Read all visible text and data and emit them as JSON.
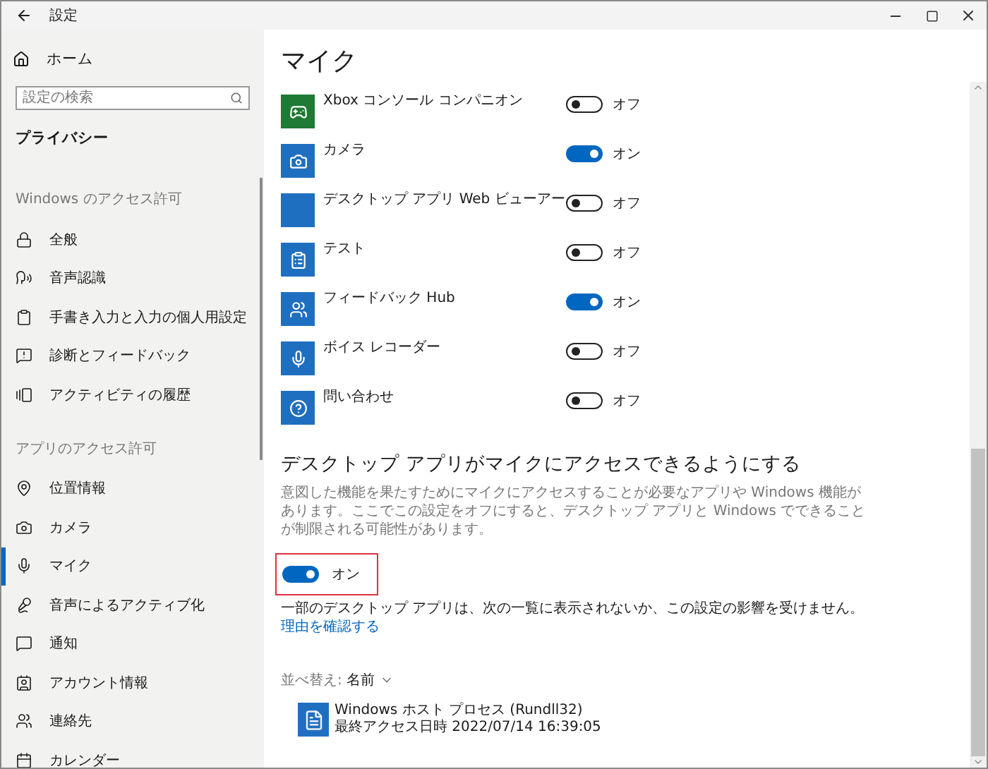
{
  "window": {
    "title": "設定"
  },
  "sidebar": {
    "home": "ホーム",
    "search": {
      "placeholder": "設定の検索"
    },
    "category": "プライバシー",
    "sections": [
      {
        "heading": "Windows のアクセス許可",
        "items": [
          {
            "label": "全般",
            "kind": "lock",
            "selected": false
          },
          {
            "label": "音声認識",
            "kind": "speech",
            "selected": false
          },
          {
            "label": "手書き入力と入力の個人用設定",
            "kind": "clipboard",
            "selected": false
          },
          {
            "label": "診断とフィードバック",
            "kind": "feedback",
            "selected": false
          },
          {
            "label": "アクティビティの履歴",
            "kind": "history",
            "selected": false
          }
        ]
      },
      {
        "heading": "アプリのアクセス許可",
        "items": [
          {
            "label": "位置情報",
            "kind": "location",
            "selected": false
          },
          {
            "label": "カメラ",
            "kind": "camera",
            "selected": false
          },
          {
            "label": "マイク",
            "kind": "mic",
            "selected": true
          },
          {
            "label": "音声によるアクティブ化",
            "kind": "voice",
            "selected": false
          },
          {
            "label": "通知",
            "kind": "notification",
            "selected": false
          },
          {
            "label": "アカウント情報",
            "kind": "account",
            "selected": false
          },
          {
            "label": "連絡先",
            "kind": "contacts",
            "selected": false
          },
          {
            "label": "カレンダー",
            "kind": "calendar",
            "selected": false
          }
        ]
      }
    ]
  },
  "main": {
    "title": "マイク",
    "apps": [
      {
        "name": "Xbox コンソール コンパニオン",
        "kind": "console",
        "color": "#1e7a34",
        "on": false,
        "state": "オフ"
      },
      {
        "name": "カメラ",
        "kind": "camera",
        "color": "#1f6fc0",
        "on": true,
        "state": "オン"
      },
      {
        "name": "デスクトップ アプリ Web ビューアー",
        "kind": "blank",
        "color": "#1f6fc0",
        "on": false,
        "state": "オフ"
      },
      {
        "name": "テスト",
        "kind": "test",
        "color": "#1f6fc0",
        "on": false,
        "state": "オフ"
      },
      {
        "name": "フィードバック Hub",
        "kind": "feedback",
        "color": "#1f6fc0",
        "on": true,
        "state": "オン"
      },
      {
        "name": "ボイス レコーダー",
        "kind": "recorder",
        "color": "#1f6fc0",
        "on": false,
        "state": "オフ"
      },
      {
        "name": "問い合わせ",
        "kind": "help",
        "color": "#1f6fc0",
        "on": false,
        "state": "オフ"
      }
    ],
    "desktop": {
      "heading": "デスクトップ アプリがマイクにアクセスできるようにする",
      "description": "意図した機能を果たすためにマイクにアクセスすることが必要なアプリや Windows 機能があります。ここでこの設定をオフにすると、デスクトップ アプリと Windows でできることが制限される可能性があります。",
      "toggle": {
        "on": true,
        "state": "オン",
        "highlighted": true
      },
      "note": "一部のデスクトップ アプリは、次の一覧に表示されないか、この設定の影響を受けません。",
      "link": "理由を確認する",
      "sort": {
        "label": "並べ替え:",
        "value": "名前"
      },
      "processes": [
        {
          "name": "Windows ホスト プロセス (Rundll32)",
          "last_access": "最終アクセス日時 2022/07/14 16:39:05"
        }
      ]
    }
  }
}
